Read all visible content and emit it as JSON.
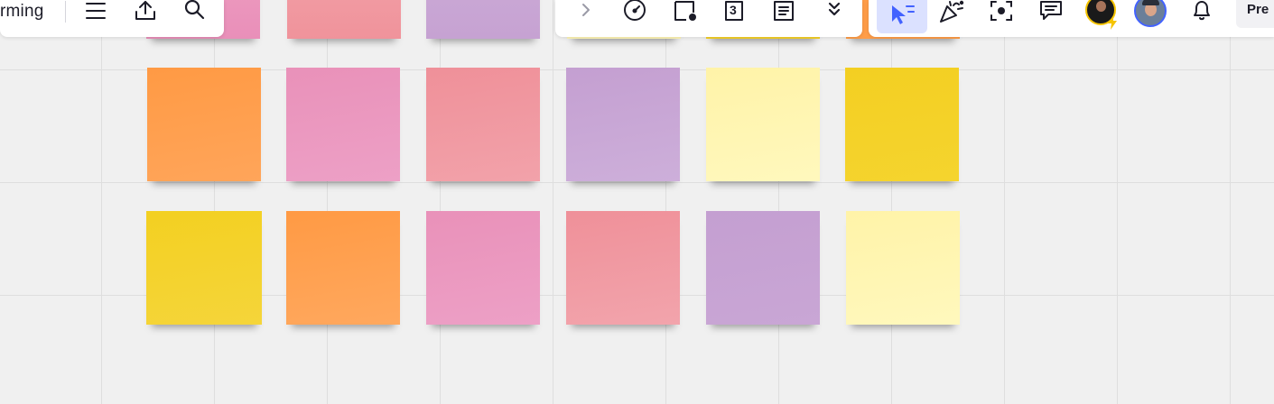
{
  "board": {
    "title_fragment": "rming",
    "sticky_colors": {
      "orange": "#ff9d48",
      "pink": "#ea94bb",
      "red": "#f0939b",
      "violet": "#c6a2d2",
      "light_yellow": "#fff6b6",
      "yellow": "#f5d128"
    },
    "rows": [
      [
        "pink",
        "red",
        "violet",
        "light_yellow",
        "yellow",
        "orange"
      ],
      [
        "orange",
        "pink",
        "red",
        "violet",
        "light_yellow",
        "yellow"
      ],
      [
        "yellow",
        "orange",
        "pink",
        "red",
        "violet",
        "light_yellow"
      ]
    ]
  },
  "toolbar_left": {
    "icons": [
      "menu-icon",
      "upload-icon",
      "search-icon"
    ]
  },
  "toolbar_center": {
    "icons": [
      "chevron-right-icon",
      "timer-icon",
      "card-icon",
      "calendar-icon",
      "document-icon",
      "chevrons-down-icon"
    ],
    "calendar_number": "3"
  },
  "toolbar_right": {
    "icons": [
      "select-pointer-icon",
      "celebrate-icon",
      "focus-icon",
      "comments-icon",
      "avatar-1",
      "avatar-2",
      "bell-icon"
    ],
    "present_label": "Pre",
    "accent": "#4262ff",
    "active_bg": "#dbe1ff"
  }
}
